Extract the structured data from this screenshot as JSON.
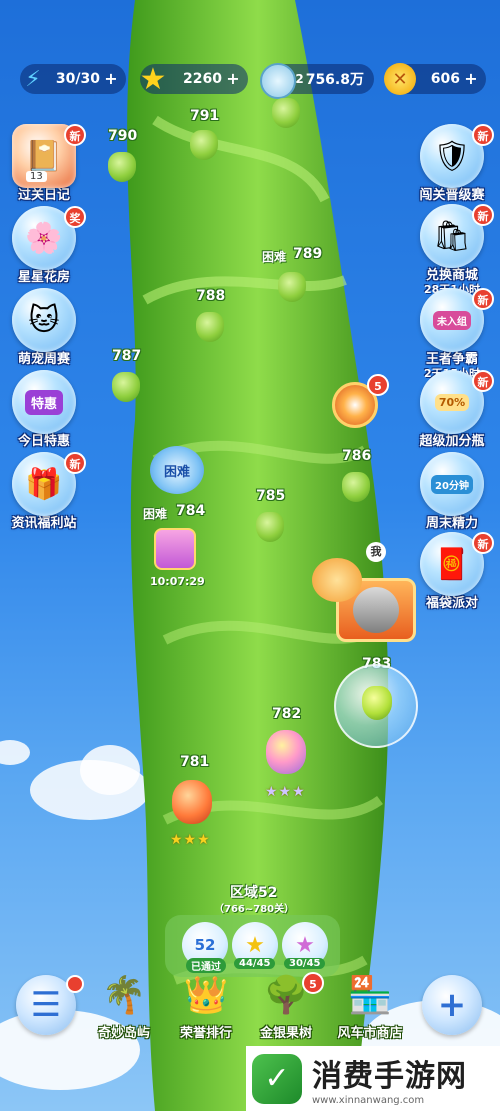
{
  "resources": {
    "energy": {
      "value": "30/30",
      "icon": "lightning-icon"
    },
    "stars": {
      "value": "2260",
      "icon": "star-icon"
    },
    "coins": {
      "value": "756.8万",
      "prefix": "2",
      "icon": "coin-icon"
    },
    "gems": {
      "value": "606",
      "icon": "gold-token-icon"
    },
    "plus": "+"
  },
  "left_menu": [
    {
      "label": "过关日记",
      "badge": "新",
      "sub": "13"
    },
    {
      "label": "星星花房",
      "badge": "奖"
    },
    {
      "label": "萌宠周赛"
    },
    {
      "label": "今日特惠",
      "inner": "特惠"
    },
    {
      "label": "资讯福利站",
      "badge": "新"
    }
  ],
  "right_menu": [
    {
      "label": "闯关晋级赛",
      "badge": "新"
    },
    {
      "label": "兑换商城",
      "badge": "新",
      "sub": "28天1小时"
    },
    {
      "label": "王者争霸",
      "badge": "新",
      "sub": "2天15小时",
      "tag": "未入组"
    },
    {
      "label": "超级加分瓶",
      "badge": "新",
      "tag": "70%"
    },
    {
      "label": "周末精力",
      "tag": "20分钟"
    },
    {
      "label": "福袋派对",
      "badge": "新"
    }
  ],
  "levels": {
    "l791": "791",
    "l790": "790",
    "l789": "789",
    "l788": "788",
    "l787": "787",
    "l786": "786",
    "l785": "785",
    "l784": "784",
    "l783": "783",
    "l782": "782",
    "l781": "781",
    "hard": "困难",
    "hard_flower": "困难",
    "timer": "10:07:29",
    "me": "我",
    "spinner_badge": "5",
    "stars_782": "★★★",
    "stars_781": "★★★"
  },
  "region": {
    "title": "区域52",
    "range": "（766~780关）",
    "passed_num": "52",
    "passed_label": "已通过",
    "stars": "44/45",
    "rainbow_stars": "30/45"
  },
  "bottom": {
    "menu_badge": "",
    "island": "奇妙岛屿",
    "ranking": "荣誉排行",
    "tree": "金银果树",
    "tree_badge": "5",
    "shop": "风车市商店",
    "plus": "+"
  },
  "watermark": {
    "text": "消费手游网",
    "url": "www.xinnanwang.com"
  },
  "colors": {
    "sky_top": "#1e6fd9",
    "stalk": "#5dbb2c",
    "badge": "#e8402f"
  }
}
